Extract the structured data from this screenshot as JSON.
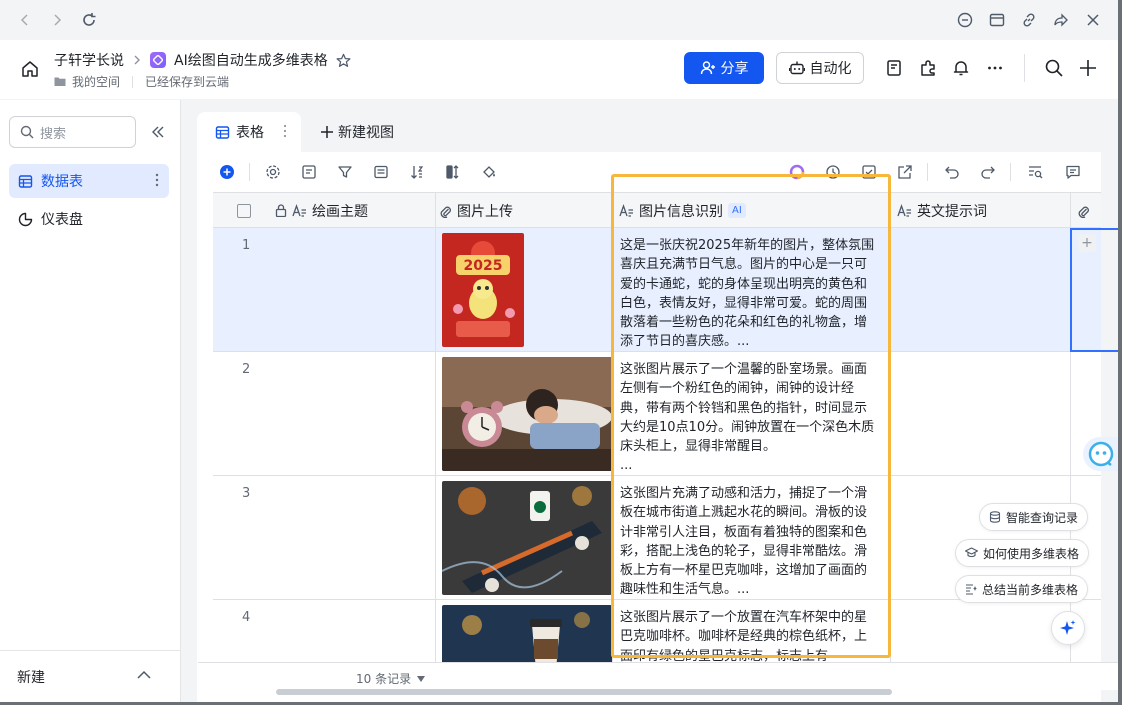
{
  "header": {
    "workspace_name": "子轩学长说",
    "doc_title": "AI绘图自动生成多维表格",
    "location": "我的空间",
    "save_status": "已经保存到云端",
    "share_label": "分享",
    "automation_label": "自动化"
  },
  "sidebar": {
    "search_placeholder": "搜索",
    "items": [
      {
        "label": "数据表",
        "active": true
      },
      {
        "label": "仪表盘",
        "active": false
      }
    ],
    "new_label": "新建"
  },
  "view_tabs": {
    "active_tab": "表格",
    "new_view_label": "新建视图"
  },
  "table": {
    "columns": [
      {
        "label": "绘画主题"
      },
      {
        "label": "图片上传"
      },
      {
        "label": "图片信息识别",
        "badge": "AI"
      },
      {
        "label": "英文提示词"
      }
    ],
    "rows": [
      {
        "num": "1",
        "description": "这是一张庆祝2025年新年的图片，整体氛围喜庆且充满节日气息。图片的中心是一只可爱的卡通蛇，蛇的身体呈现出明亮的黄色和白色，表情友好，显得非常可爱。蛇的周围散落着一些粉色的花朵和红色的礼物盒，增添了节日的喜庆感。...",
        "thumb_text": "2025"
      },
      {
        "num": "2",
        "description": "这张图片展示了一个温馨的卧室场景。画面左侧有一个粉红色的闹钟，闹钟的设计经典，带有两个铃铛和黑色的指针，时间显示大约是10点10分。闹钟放置在一个深色木质床头柜上，显得非常醒目。\n..."
      },
      {
        "num": "3",
        "description": "这张图片充满了动感和活力，捕捉了一个滑板在城市街道上溅起水花的瞬间。滑板的设计非常引人注目，板面有着独特的图案和色彩，搭配上浅色的轮子，显得非常酷炫。滑板上方有一杯星巴克咖啡，这增加了画面的趣味性和生活气息。..."
      },
      {
        "num": "4",
        "description": "这张图片展示了一个放置在汽车杯架中的星巴克咖啡杯。咖啡杯是经典的棕色纸杯，上面印有绿色的星巴克标志，标志上有"
      }
    ],
    "record_count": "10 条记录"
  },
  "floating": {
    "query_label": "智能查询记录",
    "howto_label": "如何使用多维表格",
    "summary_label": "总结当前多维表格"
  },
  "colors": {
    "accent": "#1456f0",
    "highlight": "#f6b73c",
    "selected_row": "#e8efff"
  }
}
